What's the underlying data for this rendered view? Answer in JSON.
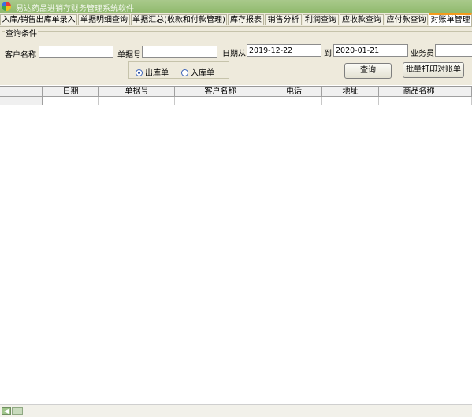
{
  "window": {
    "title": "易达药品进销存财务管理系统软件",
    "icon": "app-logo-icon"
  },
  "tabs": [
    "入库/销售出库单录入",
    "单据明细查询",
    "单据汇总(收款和付款管理)",
    "库存报表",
    "销售分析",
    "利润查询",
    "应收款查询",
    "应付款查询",
    "对账单管理"
  ],
  "active_tab": "对账单管理",
  "query": {
    "group_title": "查询条件",
    "customer_label": "客户名称",
    "customer_value": "",
    "doc_no_label": "单据号",
    "doc_no_value": "",
    "date_from_label": "日期从",
    "date_from_value": "2019-12-22",
    "date_to_label": "到",
    "date_to_value": "2020-01-21",
    "salesman_label": "业务员",
    "salesman_value": "",
    "radio_out": "出库单",
    "radio_in": "入库单",
    "radio_selected": "出库单",
    "search_button": "查询",
    "batch_print_button": "批量打印对账单"
  },
  "grid": {
    "columns": [
      "日期",
      "单据号",
      "客户名称",
      "电话",
      "地址",
      "商品名称"
    ],
    "rows": []
  },
  "colors": {
    "titlebar": "#9dc27b",
    "panel": "#eeeadc",
    "active_tab_accent": "#f39a1c"
  }
}
